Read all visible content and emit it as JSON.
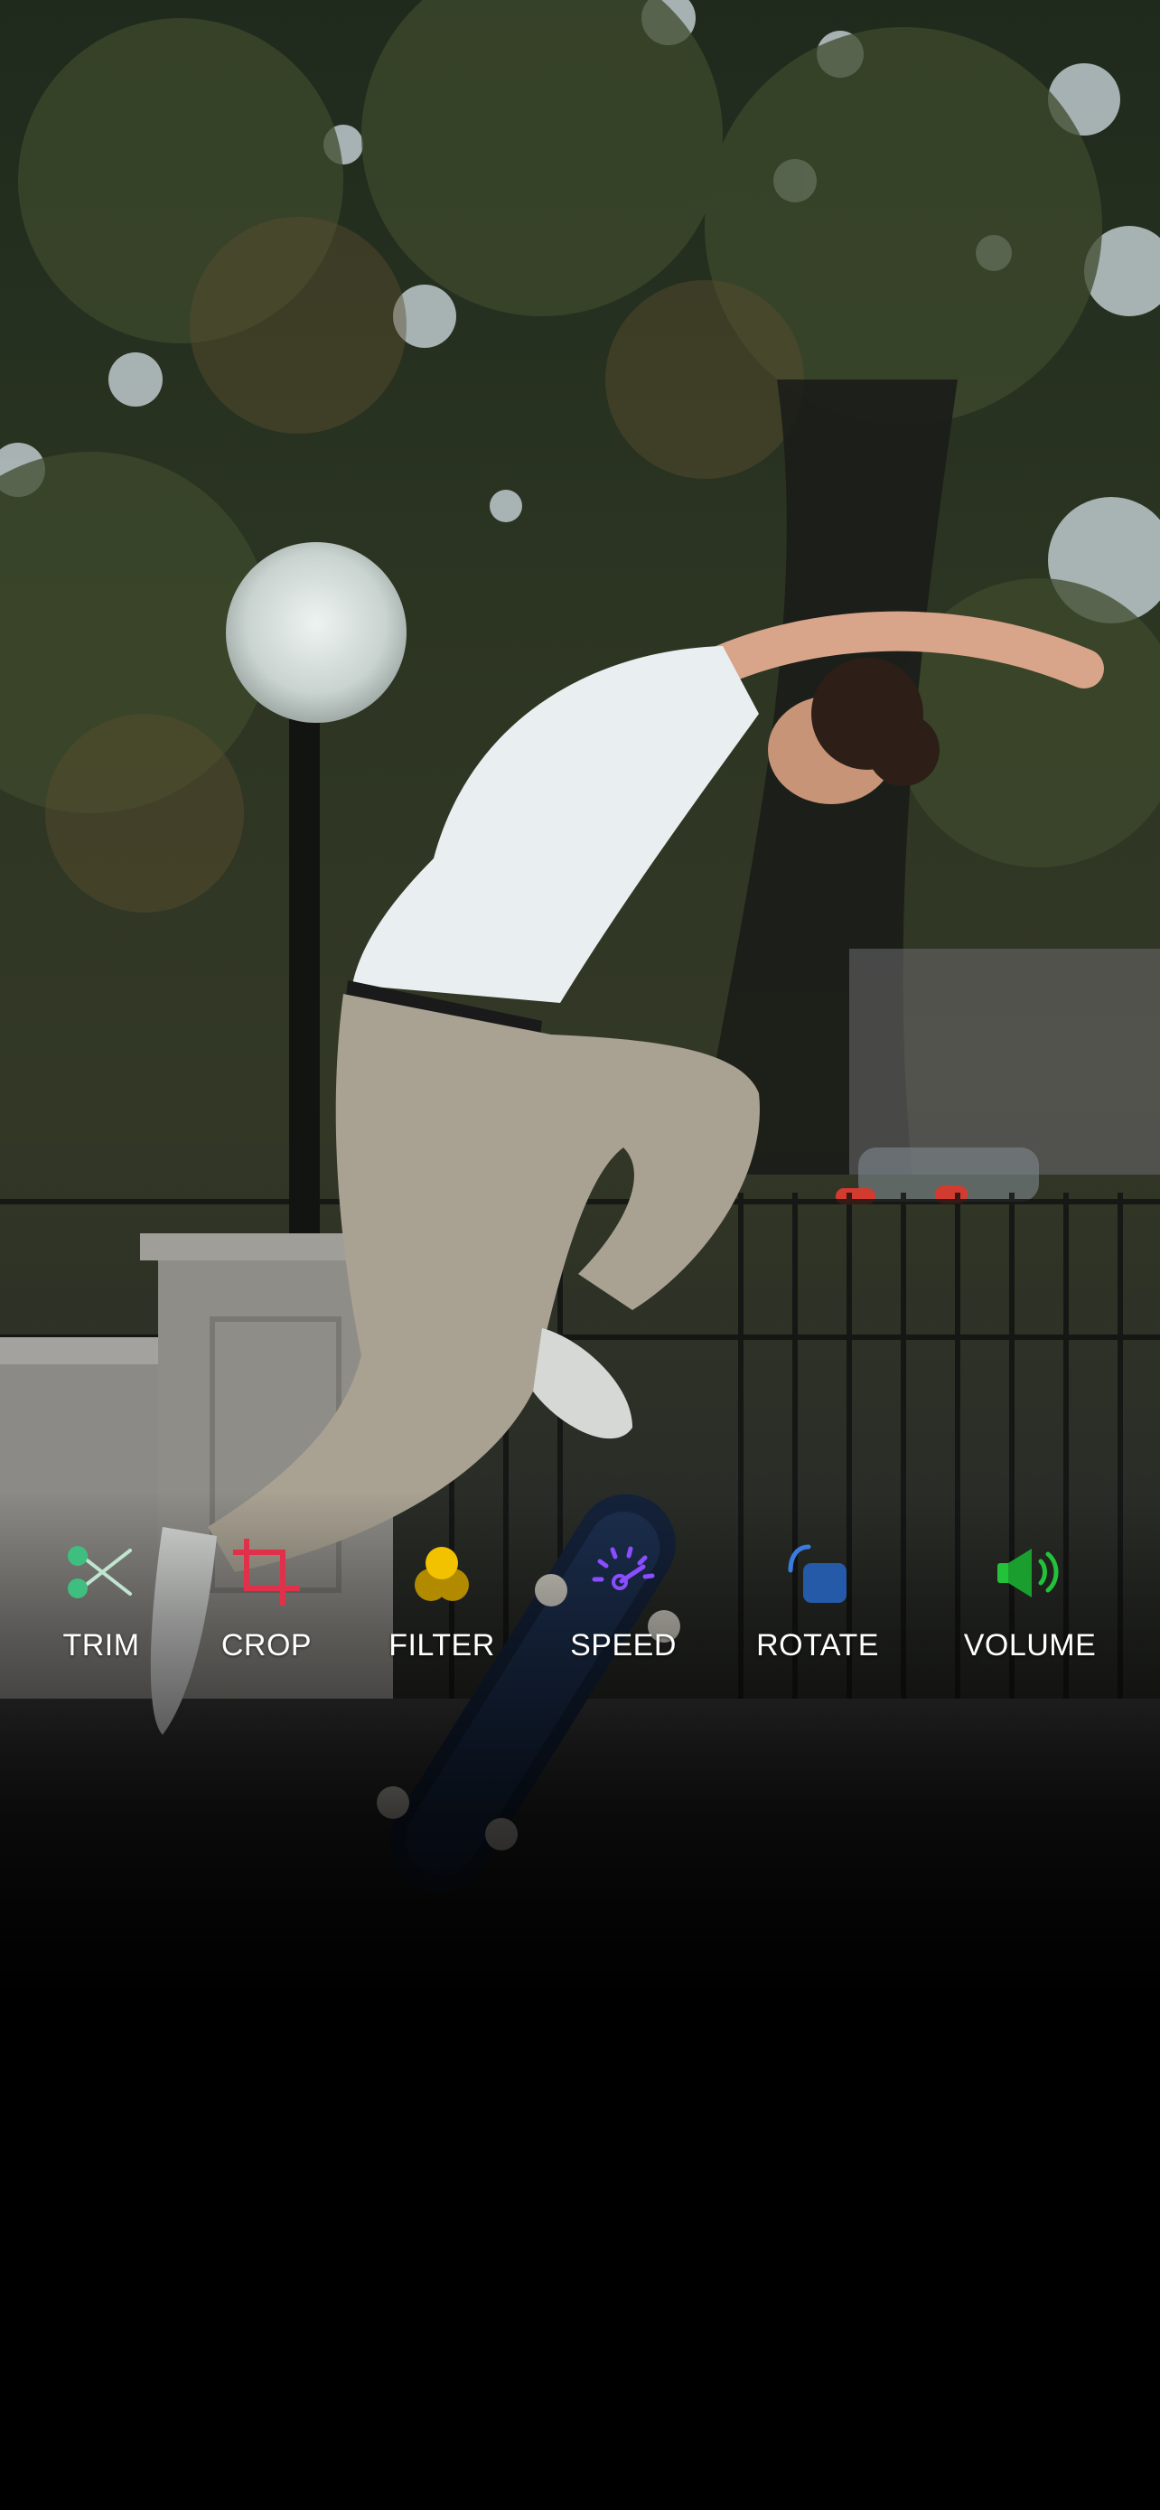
{
  "toolbar": {
    "items": [
      {
        "id": "trim",
        "label": "TRIM",
        "icon": "scissors-icon",
        "color": "#3fbf7f"
      },
      {
        "id": "crop",
        "label": "CROP",
        "icon": "crop-icon",
        "color": "#e0304a"
      },
      {
        "id": "filter",
        "label": "FILTER",
        "icon": "filter-icon",
        "color": "#f2c200"
      },
      {
        "id": "speed",
        "label": "SPEED",
        "icon": "speedometer-icon",
        "color": "#8a4dff"
      },
      {
        "id": "rotate",
        "label": "ROTATE",
        "icon": "rotate-icon",
        "color": "#3a7be0"
      },
      {
        "id": "volume",
        "label": "VOLUME",
        "icon": "speaker-icon",
        "color": "#22c23a"
      }
    ]
  }
}
